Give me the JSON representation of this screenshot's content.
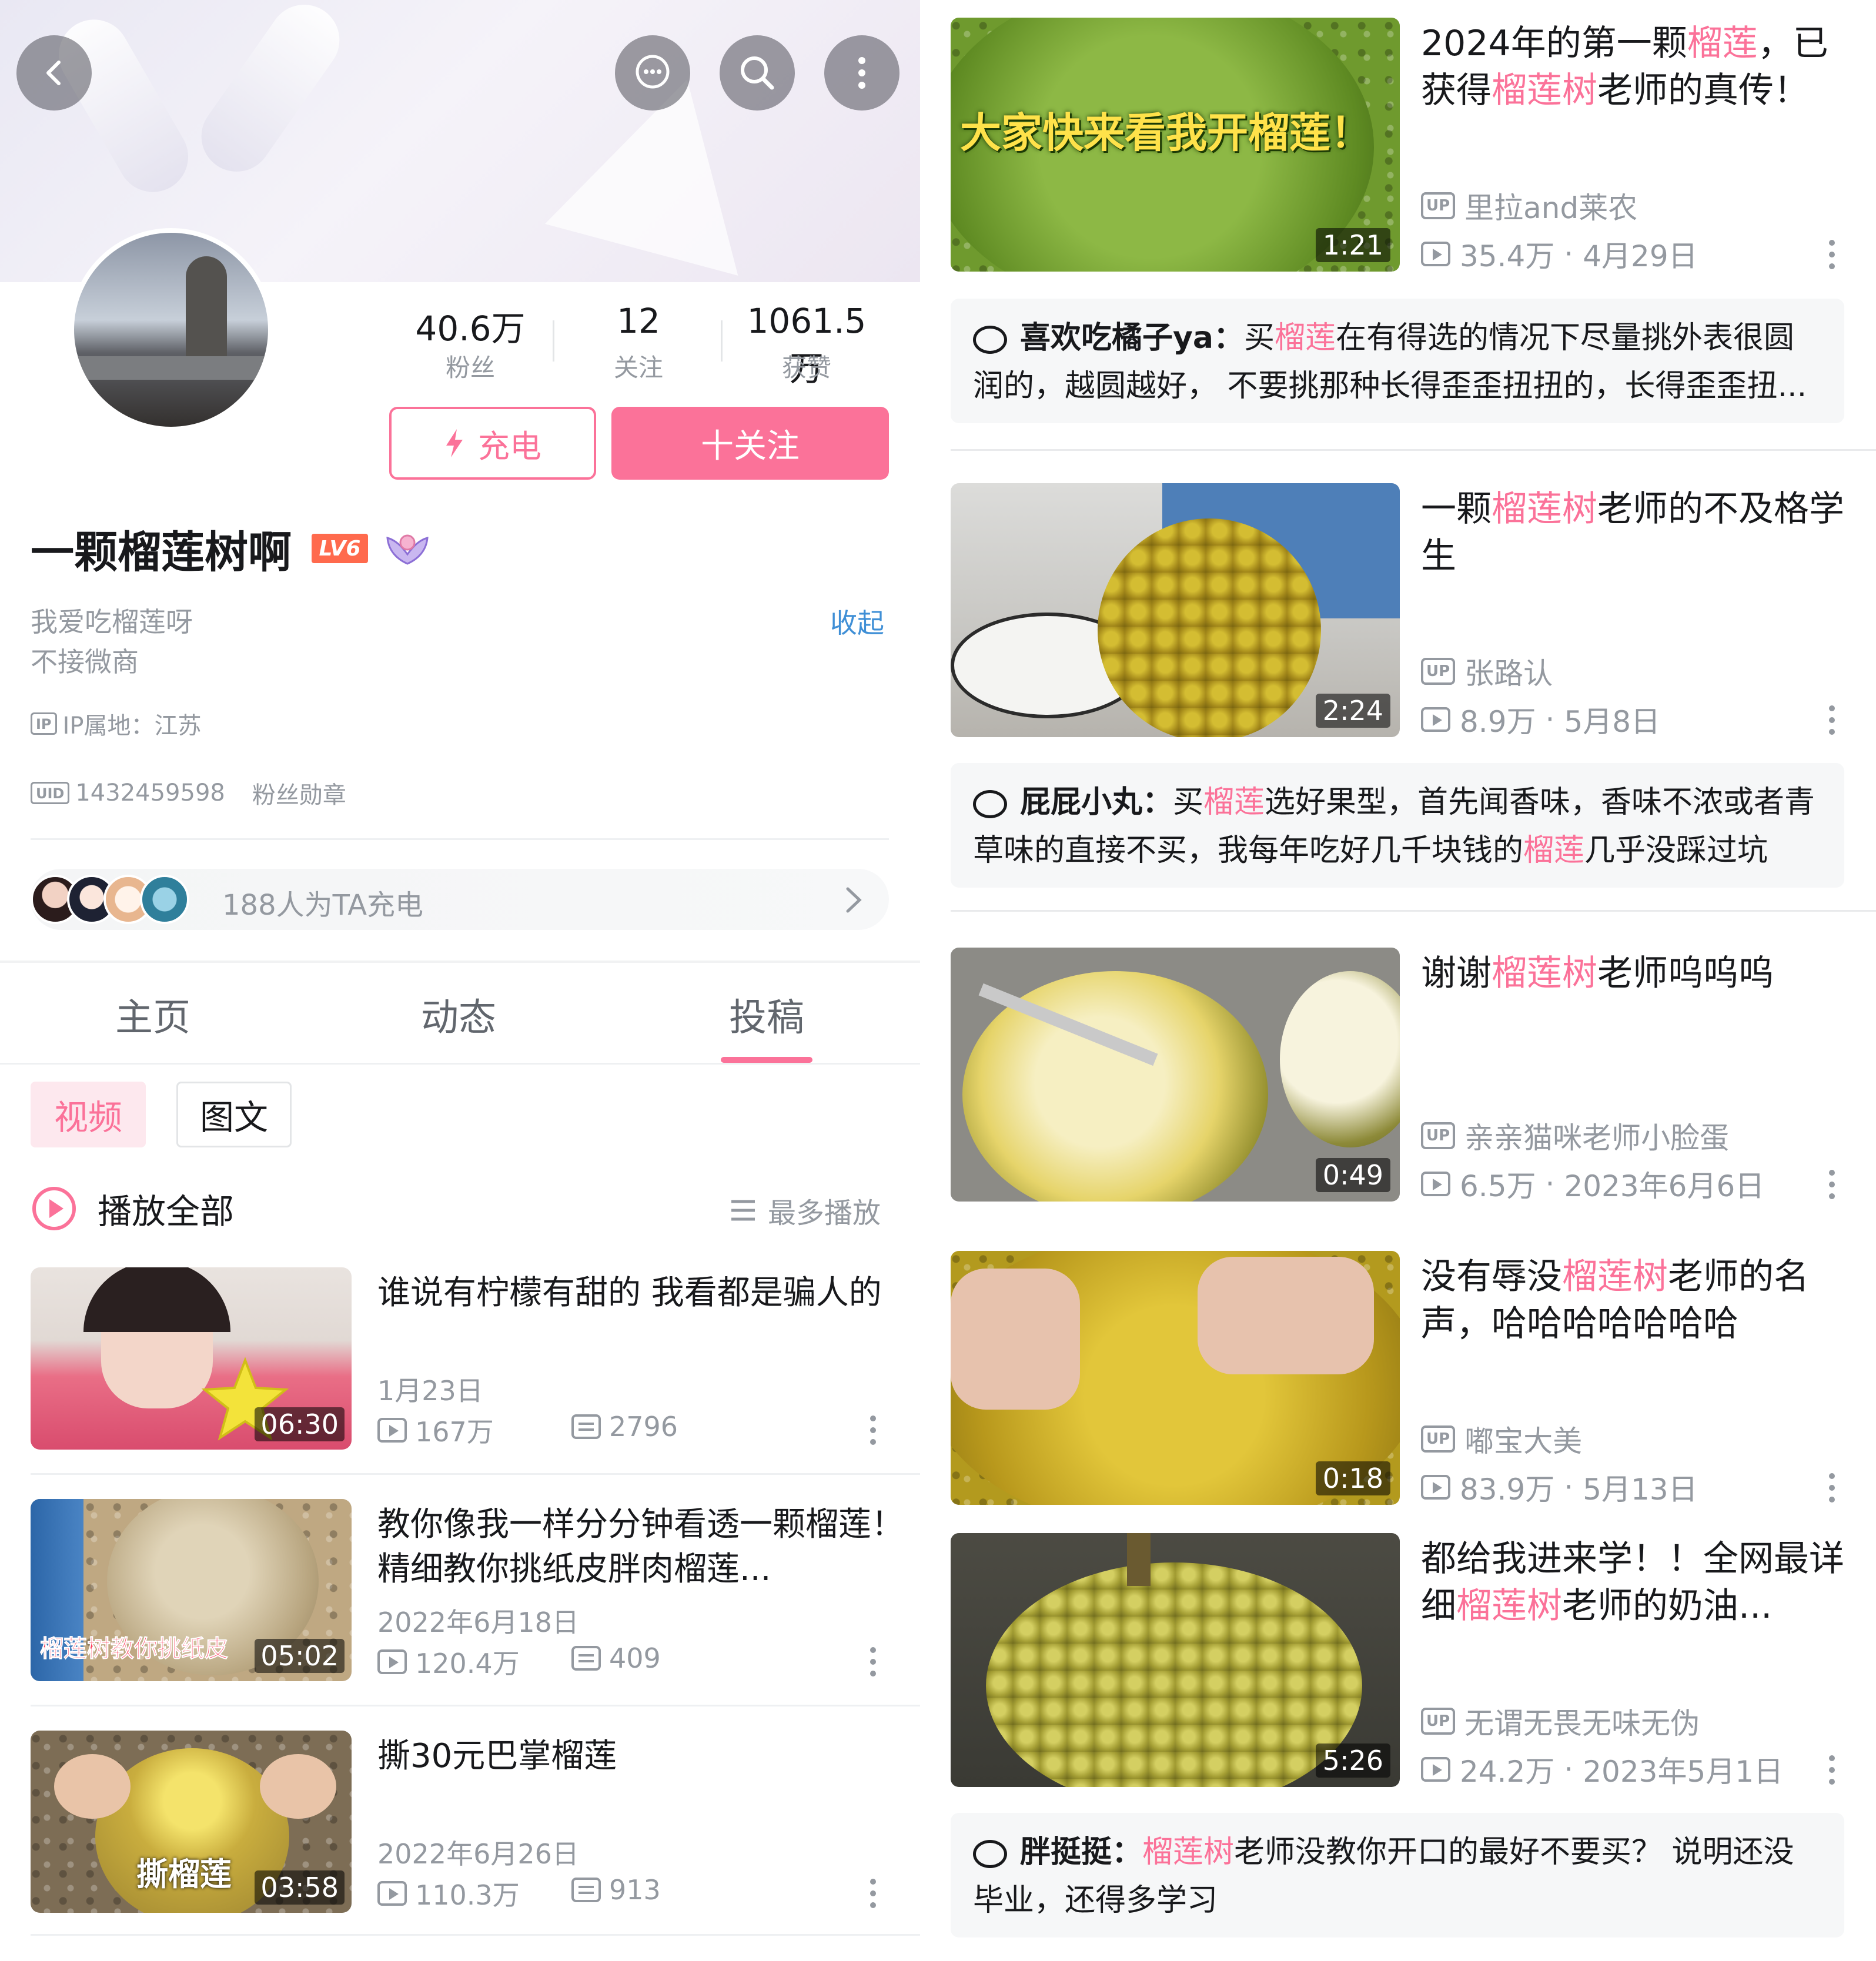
{
  "left": {
    "profile": {
      "stats": [
        {
          "value": "40.6万",
          "label": "粉丝"
        },
        {
          "value": "12",
          "label": "关注"
        },
        {
          "value": "1061.5万",
          "label": "获赞"
        }
      ],
      "charge_label": "充电",
      "follow_label": "十关注",
      "username": "一颗榴莲树啊",
      "level": "LV6",
      "bio_line1": "我爱吃榴莲呀",
      "bio_line2": "不接微商",
      "collapse_label": "收起",
      "ip_tag": "IP",
      "ip_location": "IP属地：江苏",
      "uid_tag": "UID",
      "uid": "1432459598",
      "fan_badge": "粉丝勋章",
      "chargers_text": "188人为TA充电"
    },
    "tabs": [
      "主页",
      "动态",
      "投稿"
    ],
    "subtabs": [
      "视频",
      "图文"
    ],
    "play_all": "播放全部",
    "sort_label": "最多播放",
    "videos": [
      {
        "title": "谁说有柠檬有甜的 我看都是骗人的",
        "date": "1月23日",
        "views": "167万",
        "comments": "2796",
        "duration": "06:30",
        "overlay": ""
      },
      {
        "title": "教你像我一样分分钟看透一颗榴莲！精细教你挑纸皮胖肉榴莲...",
        "date": "2022年6月18日",
        "views": "120.4万",
        "comments": "409",
        "duration": "05:02",
        "overlay": "榴莲树教你挑纸皮"
      },
      {
        "title": "撕30元巴掌榴莲",
        "date": "2022年6月26日",
        "views": "110.3万",
        "comments": "913",
        "duration": "03:58",
        "overlay": "撕榴莲"
      }
    ]
  },
  "right": {
    "up_tag": "UP",
    "videos": [
      {
        "title_pre": "2024年的第一颗",
        "title_hl": "榴莲",
        "title_post": "，已获得",
        "title_hl2": "榴莲树",
        "title_post2": "老师的真传！",
        "uploader": "里拉and莱农",
        "views": "35.4万",
        "date": "4月29日",
        "duration": "1:21",
        "overlay": "大家快来看我开榴莲！"
      },
      {
        "title_pre": "一颗",
        "title_hl": "榴莲树",
        "title_post": "老师的不及格学生",
        "title_hl2": "",
        "title_post2": "",
        "uploader": "张路认",
        "views": "8.9万",
        "date": "5月8日",
        "duration": "2:24",
        "overlay": ""
      },
      {
        "title_pre": "谢谢",
        "title_hl": "榴莲树",
        "title_post": "老师呜呜呜",
        "title_hl2": "",
        "title_post2": "",
        "uploader": "亲亲猫咪老师小脸蛋",
        "views": "6.5万",
        "date": "2023年6月6日",
        "duration": "0:49",
        "overlay": ""
      },
      {
        "title_pre": "没有辱没",
        "title_hl": "榴莲树",
        "title_post": "老师的名声，哈哈哈哈哈哈哈",
        "title_hl2": "",
        "title_post2": "",
        "uploader": "嘟宝大美",
        "views": "83.9万",
        "date": "5月13日",
        "duration": "0:18",
        "overlay": ""
      },
      {
        "title_pre": "都给我进来学！！全网最详细",
        "title_hl": "榴莲树",
        "title_post": "老师的奶油...",
        "title_hl2": "",
        "title_post2": "",
        "uploader": "无谓无畏无味无伪",
        "views": "24.2万",
        "date": "2023年5月1日",
        "duration": "5:26",
        "overlay": ""
      }
    ],
    "comments": [
      {
        "user": "喜欢吃橘子ya：",
        "t1": "买",
        "h1": "榴莲",
        "t2": "在有得选的情况下尽量挑外表很圆润的，越圆越好， 不要挑那种长得歪歪扭扭的，长得歪歪扭...",
        "h2": "",
        "t3": ""
      },
      {
        "user": "屁屁小丸：",
        "t1": "买",
        "h1": "榴莲",
        "t2": "选好果型，首先闻香味，香味不浓或者青草味的直接不买，我每年吃好几千块钱的",
        "h2": "榴莲",
        "t3": "几乎没踩过坑"
      },
      {
        "user": "胖挺挺：",
        "t1": "",
        "h1": "榴莲树",
        "t2": "老师没教你开口的最好不要买？ 说明还没毕业，还得多学习",
        "h2": "",
        "t3": ""
      }
    ]
  },
  "colors": {
    "accent": "#fb7299",
    "link": "#3f8fd6",
    "text": "#18191c",
    "muted": "#9499a0"
  }
}
